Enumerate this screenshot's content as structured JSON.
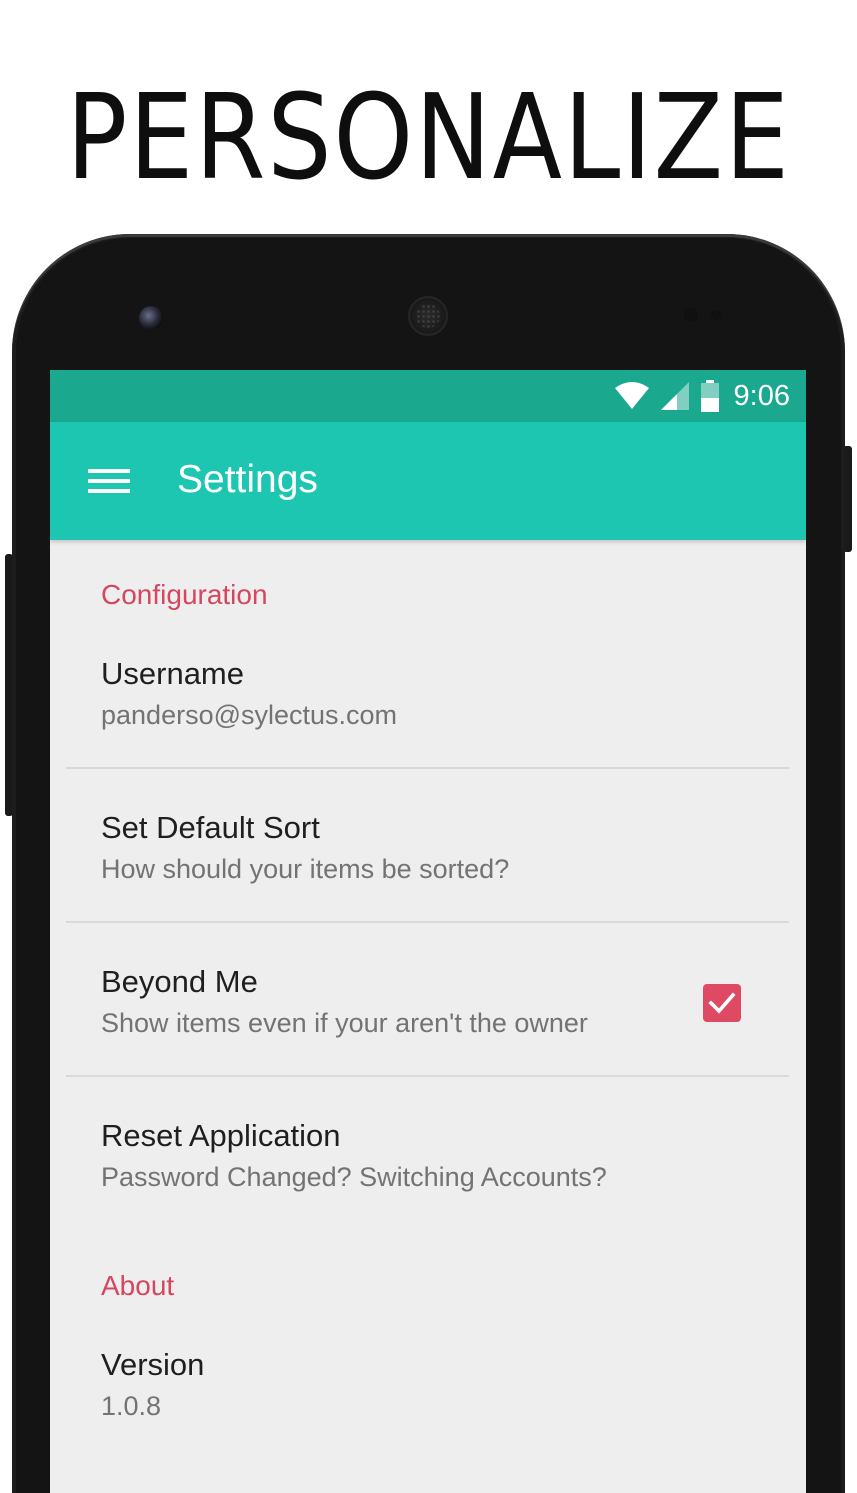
{
  "promo": {
    "headline": "PERSONALIZE"
  },
  "statusbar": {
    "time": "9:06",
    "icons": [
      "wifi-icon",
      "cell-signal-icon",
      "battery-icon"
    ],
    "color": "#1aa88f"
  },
  "appbar": {
    "title": "Settings",
    "menu_icon": "hamburger-menu-icon",
    "color": "#1dc6b0"
  },
  "sections": [
    {
      "header": "Configuration",
      "items": [
        {
          "title": "Username",
          "summary": "panderso@sylectus.com"
        },
        {
          "title": "Set Default Sort",
          "summary": "How should your items be sorted?"
        },
        {
          "title": "Beyond Me",
          "summary": "Show items even if your aren't the owner",
          "checked": true
        },
        {
          "title": "Reset Application",
          "summary": "Password Changed? Switching Accounts?"
        }
      ]
    },
    {
      "header": "About",
      "items": [
        {
          "title": "Version",
          "summary": "1.0.8"
        }
      ]
    }
  ],
  "colors": {
    "accent": "#de4a63",
    "section_header": "#d5465f",
    "background": "#eeeeee"
  }
}
